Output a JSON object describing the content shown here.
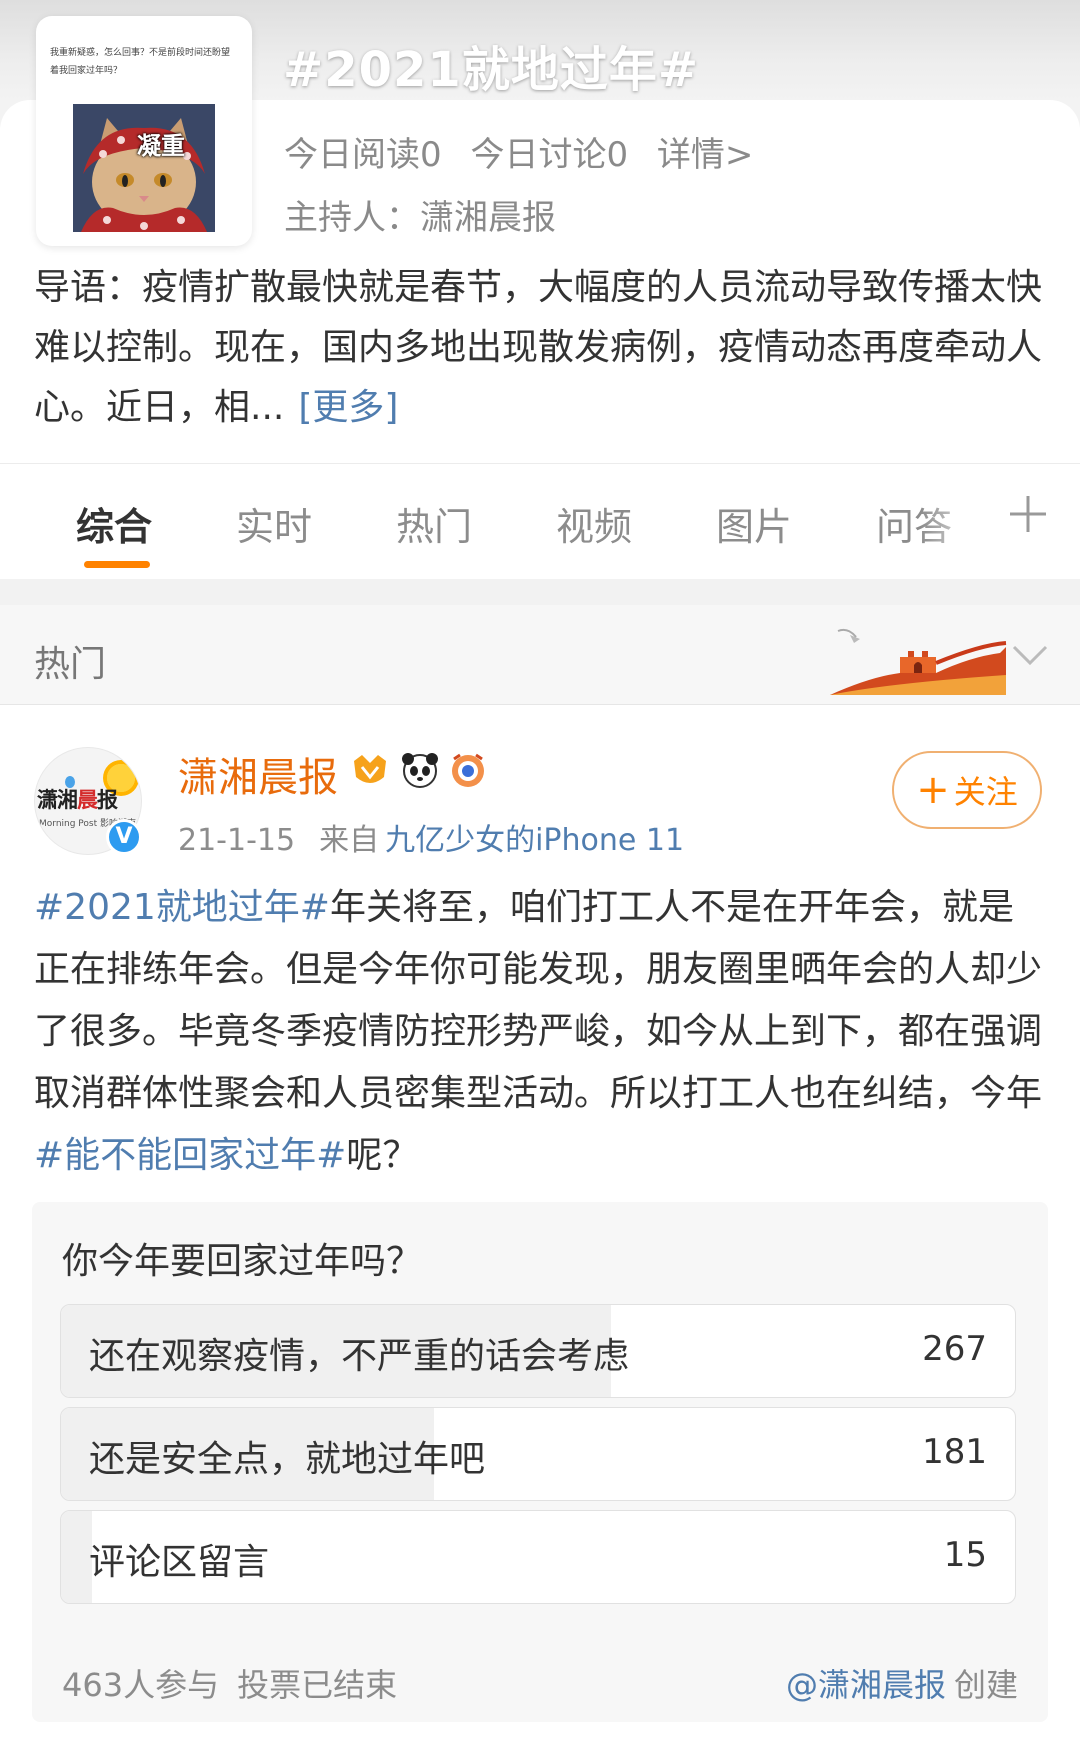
{
  "topic": {
    "title": "#2021就地过年#",
    "reads": "今日阅读0",
    "discussions": "今日讨论0",
    "details_link": "详情>",
    "host": "主持人：潇湘晨报",
    "intro": "导语：疫情扩散最快就是春节，大幅度的人员流动导致传播太快难以控制。现在，国内多地出现散发病例，疫情动态再度牵动人心。近日，相...",
    "more_link": "[更多]",
    "cover": {
      "caption": "我重新疑惑，怎么回事？不是前段时间还盼望着我回家过年吗？",
      "badge": "凝重"
    }
  },
  "tabs": {
    "items": [
      "综合",
      "实时",
      "热门",
      "视频",
      "图片",
      "问答"
    ],
    "active": "综合",
    "plus_icon": "plus-icon"
  },
  "hot_section": {
    "label": "热门",
    "expand_icon": "chevron-down-icon"
  },
  "post": {
    "author": "潇湘晨报",
    "avatar": {
      "line1_a": "潇湘",
      "line1_b": "晨",
      "line1_c": "报",
      "line2": "Morning Post 影响湖南"
    },
    "verified_mark": "V",
    "date": "21-1-15",
    "source_prefix": "来自",
    "source": "九亿少女的iPhone 11",
    "follow_label": "关注",
    "follow_plus": "+",
    "body": {
      "tag1": "#2021就地过年#",
      "text1": "年关将至，咱们打工人不是在开年会，就是正在排练年会。但是今年你可能发现，朋友圈里晒年会的人却少了很多。毕竟冬季疫情防控形势严峻，如今从上到下，都在强调取消群体性聚会和人员密集型活动。所以打工人也在纠结，今年",
      "tag2": "#能不能回家过年#",
      "text2": "呢？"
    },
    "poll": {
      "question": "你今年要回家过年吗？",
      "options": [
        {
          "label": "还在观察疫情，不严重的话会考虑",
          "count": "267",
          "share": 0.577
        },
        {
          "label": "还是安全点，就地过年吧",
          "count": "181",
          "share": 0.391
        },
        {
          "label": "评论区留言",
          "count": "15",
          "share": 0.032
        }
      ],
      "participants": "463人参与",
      "status": "投票已结束",
      "creator": "@潇湘晨报",
      "created_suffix": "创建"
    }
  },
  "colors": {
    "accent_orange": "#ff8200",
    "link_blue": "#507daf",
    "author_orange": "#e86b0c",
    "verified_blue": "#2d9bf0"
  }
}
